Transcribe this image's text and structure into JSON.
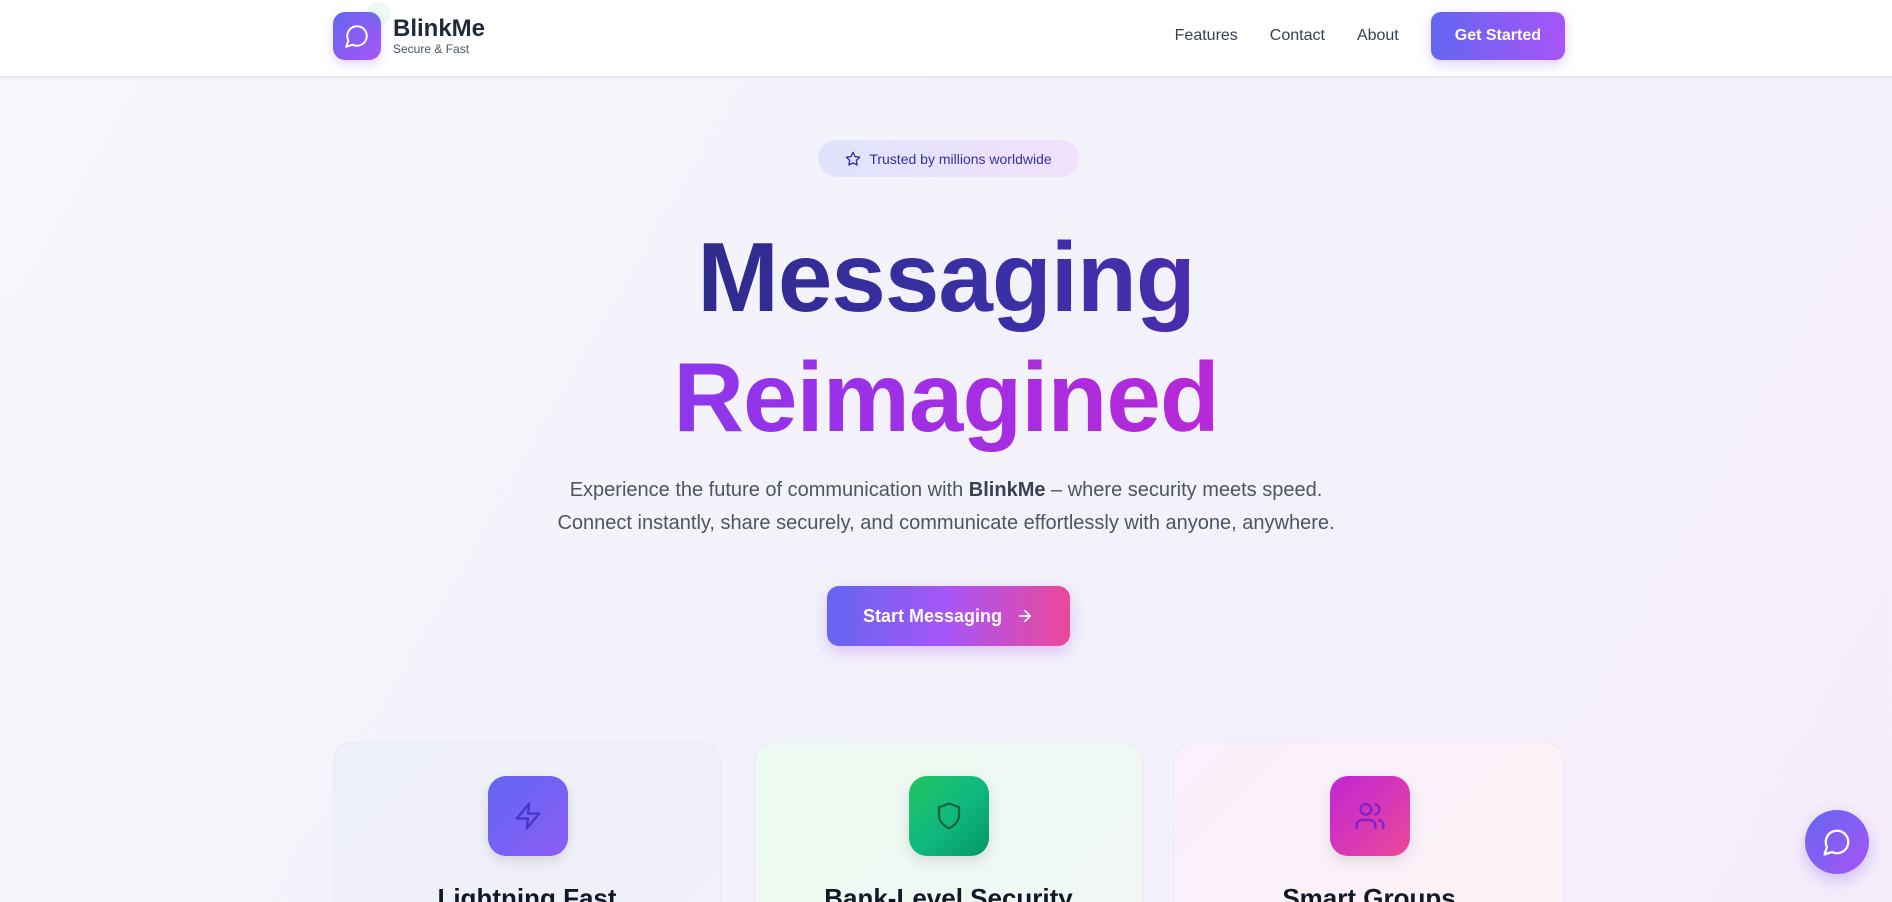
{
  "header": {
    "brand": "BlinkMe",
    "tagline": "Secure & Fast",
    "nav": [
      "Features",
      "Contact",
      "About"
    ],
    "cta_label": "Get Started"
  },
  "hero": {
    "badge": "Trusted by millions worldwide",
    "title_line1": "Messaging",
    "title_line2": "Reimagined",
    "subtext_pre": "Experience the future of communication with ",
    "subtext_brand": "BlinkMe",
    "subtext_post": " – where security meets speed.",
    "subtext_line2": "Connect instantly, share securely, and communicate effortlessly with anyone, anywhere.",
    "start_label": "Start Messaging"
  },
  "features": [
    {
      "title": "Lightning Fast",
      "icon": "lightning-icon"
    },
    {
      "title": "Bank-Level Security",
      "icon": "shield-icon"
    },
    {
      "title": "Smart Groups",
      "icon": "users-icon"
    }
  ],
  "colors": {
    "accent_start": "#6366f1",
    "accent_mid": "#a855f7",
    "accent_end": "#ec4899"
  }
}
